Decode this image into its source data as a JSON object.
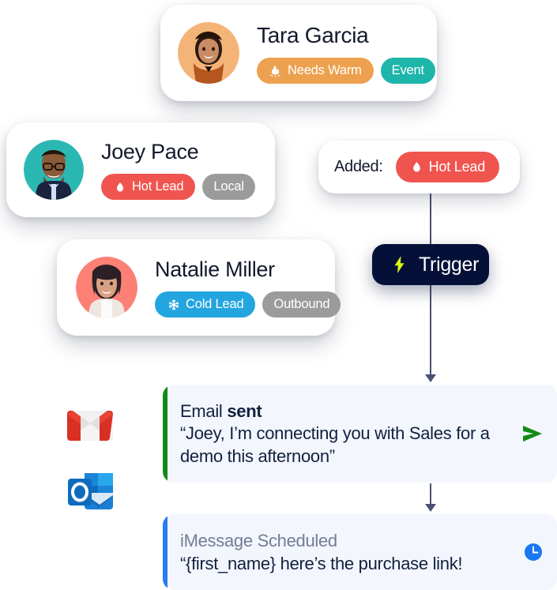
{
  "people": [
    {
      "name": "Tara Garcia",
      "avatar_bg": "#f5b477",
      "badges": [
        {
          "label": "Needs Warm",
          "color": "#eda14e",
          "icon": "campfire-icon"
        },
        {
          "label": "Event",
          "color": "#1eb5ab",
          "icon": "none"
        }
      ]
    },
    {
      "name": "Joey Pace",
      "avatar_bg": "#2bb8b3",
      "badges": [
        {
          "label": "Hot Lead",
          "color": "#f0544f",
          "icon": "flame-icon"
        },
        {
          "label": "Local",
          "color": "#9b9b9b",
          "icon": "none"
        }
      ]
    },
    {
      "name": "Natalie Miller",
      "avatar_bg": "#fc8075",
      "badges": [
        {
          "label": "Cold Lead",
          "color": "#23a5e0",
          "icon": "snowflake-icon"
        },
        {
          "label": "Outbound",
          "color": "#9b9b9b",
          "icon": "none"
        }
      ]
    }
  ],
  "added_card": {
    "label": "Added:",
    "badge": {
      "label": "Hot Lead",
      "color": "#f0544f",
      "icon": "flame-icon"
    }
  },
  "trigger": {
    "label": "Trigger",
    "icon": "lightning-bolt-icon",
    "bg": "#041037",
    "icon_color": "#d8f715"
  },
  "messages": [
    {
      "title_prefix": "Email ",
      "title_strong": "sent",
      "body": "“Joey, I’m connecting you with Sales for a demo this afternoon”",
      "accent": "#118b16",
      "action_icon": "send-arrow-icon",
      "action_color": "#118b16",
      "muted_title": false
    },
    {
      "title_prefix": "iMessage Scheduled",
      "title_strong": "",
      "body": "“{first_name} here’s the purchase link!",
      "accent": "#2a7bf0",
      "action_icon": "clock-icon",
      "action_color": "#1877f2",
      "muted_title": true
    }
  ],
  "mail_apps": [
    {
      "name": "gmail-icon"
    },
    {
      "name": "outlook-icon"
    }
  ],
  "connector_color": "#4a5272"
}
